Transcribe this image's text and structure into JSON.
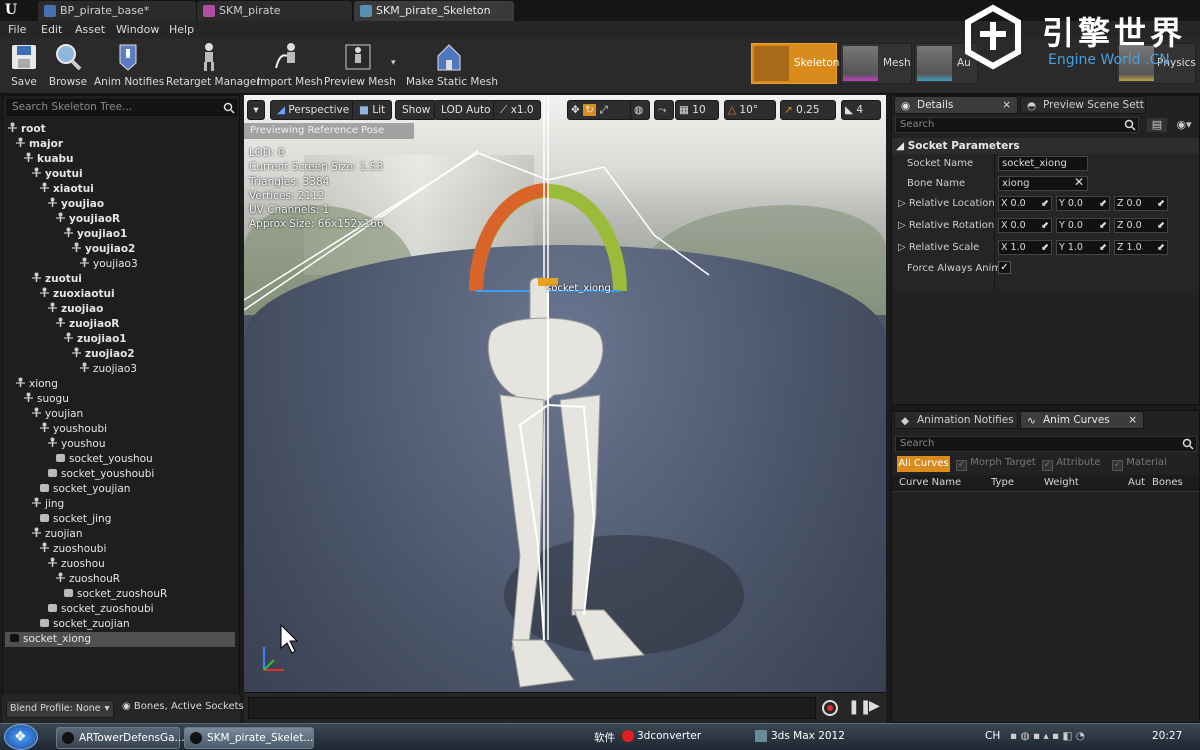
{
  "tabs": [
    {
      "label": "BP_pirate_base*"
    },
    {
      "label": "SKM_pirate"
    },
    {
      "label": "SKM_pirate_Skeleton"
    }
  ],
  "menu": [
    "File",
    "Edit",
    "Asset",
    "Window",
    "Help"
  ],
  "toolbar": {
    "buttons": [
      "Save",
      "Browse",
      "Anim Notifies",
      "Retarget Manager",
      "Import Mesh",
      "Preview Mesh",
      "Make Static Mesh"
    ],
    "modes": [
      "Skeleton",
      "Mesh",
      "Au",
      "Physics"
    ]
  },
  "watermark": {
    "text": "引擎世界",
    "sub": "Engine World .CN"
  },
  "skeleton_tree": {
    "search_placeholder": "Search Skeleton Tree...",
    "rows": [
      {
        "label": "root",
        "bold": true
      },
      {
        "label": "major",
        "bold": true
      },
      {
        "label": "kuabu",
        "bold": true
      },
      {
        "label": "youtui",
        "bold": true
      },
      {
        "label": "xiaotui",
        "bold": true
      },
      {
        "label": "youjiao",
        "bold": true
      },
      {
        "label": "youjiaoR",
        "bold": true
      },
      {
        "label": "youjiao1",
        "bold": true
      },
      {
        "label": "youjiao2",
        "bold": true
      },
      {
        "label": "youjiao3",
        "bold": false
      },
      {
        "label": "zuotui",
        "bold": true
      },
      {
        "label": "zuoxiaotui",
        "bold": true
      },
      {
        "label": "zuojiao",
        "bold": true
      },
      {
        "label": "zuojiaoR",
        "bold": true
      },
      {
        "label": "zuojiao1",
        "bold": true
      },
      {
        "label": "zuojiao2",
        "bold": true
      },
      {
        "label": "zuojiao3",
        "bold": false
      },
      {
        "label": "xiong",
        "bold": false
      },
      {
        "label": "suogu",
        "bold": false
      },
      {
        "label": "youjian",
        "bold": false
      },
      {
        "label": "youshoubi",
        "bold": false
      },
      {
        "label": "youshou",
        "bold": false
      },
      {
        "label": "socket_youshou",
        "bold": false
      },
      {
        "label": "socket_youshoubi",
        "bold": false
      },
      {
        "label": "socket_youjian",
        "bold": false
      },
      {
        "label": "jing",
        "bold": false
      },
      {
        "label": "socket_jing",
        "bold": false
      },
      {
        "label": "zuojian",
        "bold": false
      },
      {
        "label": "zuoshoubi",
        "bold": false
      },
      {
        "label": "zuoshou",
        "bold": false
      },
      {
        "label": "zuoshouR",
        "bold": false
      },
      {
        "label": "socket_zuoshouR",
        "bold": false
      },
      {
        "label": "socket_zuoshoubi",
        "bold": false
      },
      {
        "label": "socket_zuojian",
        "bold": false
      },
      {
        "label": "socket_xiong",
        "bold": false,
        "selected": true
      }
    ],
    "footer": {
      "blend_profile": "Blend Profile: None",
      "filter": "Bones, Active Sockets"
    }
  },
  "viewport": {
    "toolbar": {
      "perspective": "Perspective",
      "lit": "Lit",
      "show": "Show",
      "lod": "LOD Auto",
      "speed": "x1.0",
      "grid": "10",
      "angle": "10°",
      "scale": "0.25",
      "cam": "4"
    },
    "preview_label": "Previewing Reference Pose",
    "info": [
      "LOD: 0",
      "Current Screen Size: 1.53",
      "Triangles: 3384",
      "Vertices: 2112",
      "UV Channels: 1",
      "Approx Size: 66x152x166"
    ],
    "socket_label": "socket_xiong"
  },
  "details": {
    "tab": "Details",
    "tab2": "Preview Scene Sett",
    "search_placeholder": "Search",
    "section": "Socket Parameters",
    "socket_name_label": "Socket Name",
    "socket_name": "socket_xiong",
    "bone_name_label": "Bone Name",
    "bone_name": "xiong",
    "rel_location_label": "Relative Location",
    "rel_rotation_label": "Relative Rotation",
    "rel_scale_label": "Relative Scale",
    "loc": [
      "X 0.0",
      "Y 0.0",
      "Z 0.0"
    ],
    "rot": [
      "X 0.0",
      "Y 0.0",
      "Z 0.0"
    ],
    "scale": [
      "X 1.0",
      "Y 1.0",
      "Z 1.0"
    ],
    "force_always_label": "Force Always Animat",
    "force_always": true
  },
  "curves": {
    "tab": "Animation Notifies",
    "tab2": "Anim Curves",
    "search_placeholder": "Search",
    "filters": [
      "All Curves",
      "Morph Target",
      "Attribute",
      "Material"
    ],
    "columns": [
      "Curve Name",
      "Type",
      "Weight",
      "Aut",
      "Bones"
    ]
  },
  "taskbar": {
    "items": [
      "ARTowerDefensGa...",
      "SKM_pirate_Skelet..."
    ],
    "tray_apps": [
      "软件",
      "3dconverter",
      "3ds Max 2012"
    ],
    "lang": "CH",
    "time": "20:27"
  },
  "colors": {
    "accent_orange": "#d98c1c",
    "selected_row": "#505050"
  }
}
